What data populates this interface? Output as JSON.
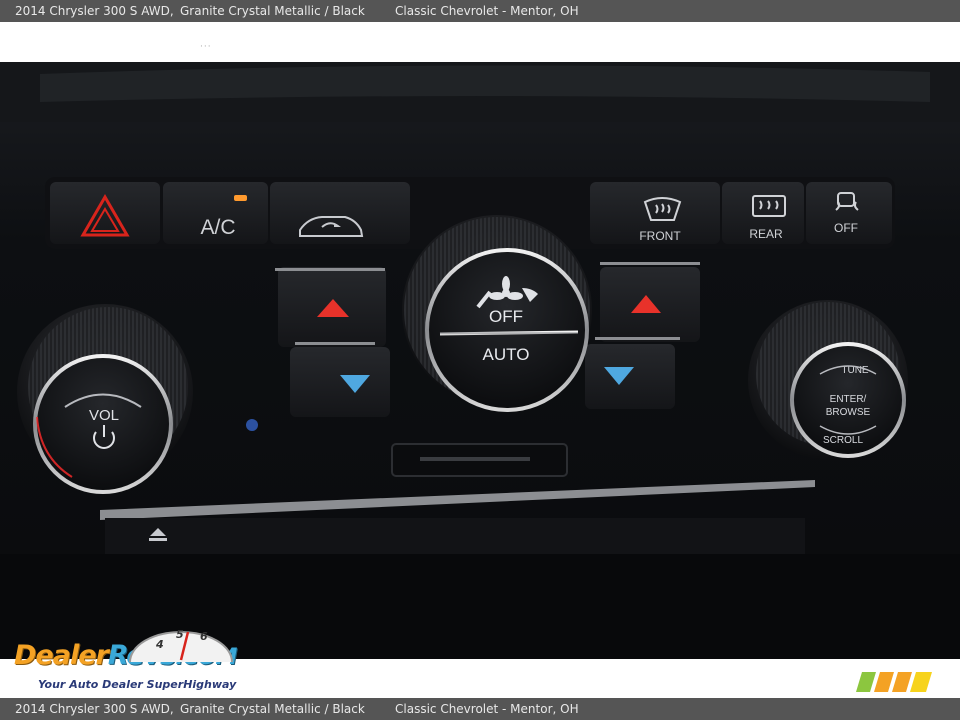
{
  "caption": {
    "vehicle": "2014 Chrysler 300 S AWD,",
    "color": "Granite Crystal Metallic / Black",
    "dealer": "Classic Chevrolet - Mentor, OH"
  },
  "watermark": {
    "brand_dealer": "Dealer",
    "brand_revs": "Revs",
    "brand_com": ".COM",
    "tagline": "Your Auto Dealer SuperHighway",
    "speedo_digits": [
      "4",
      "5",
      "6"
    ]
  },
  "controls": {
    "ac_label": "A/C",
    "front_label": "FRONT",
    "rear_label": "REAR",
    "traction_label": "OFF",
    "fan_off_label": "OFF",
    "auto_label": "AUTO",
    "vol_label": "VOL",
    "tune_label": "TUNE",
    "enter_label": "ENTER/",
    "browse_label": "BROWSE",
    "scroll_label": "SCROLL"
  },
  "colors": {
    "caption_bar": "#555555",
    "indicator_amber": "#ff9a2e",
    "temp_up_red": "#e8322a",
    "temp_down_blue": "#4fa8e0",
    "hazard_red": "#d8241c",
    "brand_orange": "#f4a224",
    "brand_blue": "#3aa8d8"
  },
  "icons": [
    "hazard-icon",
    "recirculation-car-icon",
    "front-defrost-icon",
    "rear-defrost-icon",
    "traction-control-off-icon",
    "fan-icon",
    "power-icon",
    "eject-icon"
  ]
}
